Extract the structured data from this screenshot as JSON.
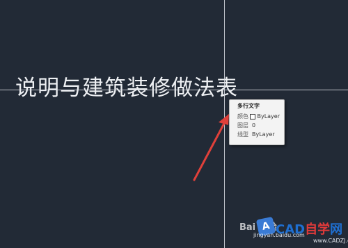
{
  "drawing": {
    "mtext_content": "说明与建筑装修做法表"
  },
  "tooltip": {
    "title": "多行文字",
    "rows": [
      {
        "key": "颜色",
        "value": "ByLayer"
      },
      {
        "key": "图层",
        "value": "0"
      },
      {
        "key": "线型",
        "value": "ByLayer"
      }
    ]
  },
  "colors": {
    "canvas_bg": "#222a36",
    "crosshair": "#d9dde3",
    "arrow": "#e0403a",
    "text": "#eef0f3"
  },
  "watermark": {
    "baidu_text": "Bai 经验",
    "brand_a": "CAD",
    "brand_b": "自学",
    "brand_c": "网",
    "url": "jingyan.baidu.com",
    "url2": "www.CADZJ.com"
  }
}
